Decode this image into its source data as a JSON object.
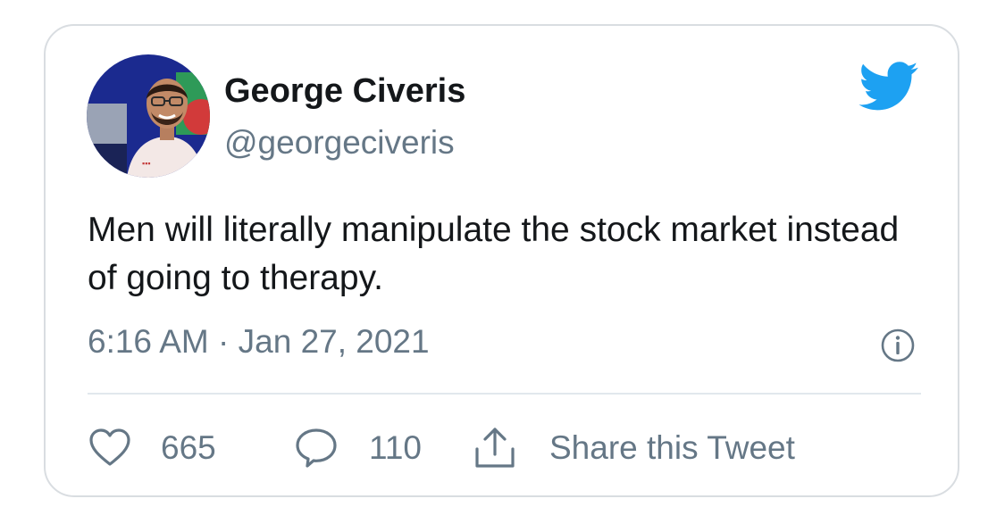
{
  "author": {
    "name": "George Civeris",
    "handle": "@georgeciveris"
  },
  "tweet": {
    "text": "Men will literally manipulate the stock market instead of going to therapy.",
    "timestamp": "6:16 AM · Jan 27, 2021"
  },
  "actions": {
    "likes": "665",
    "replies": "110",
    "share_label": "Share this Tweet"
  },
  "icons": {
    "brand": "twitter-bird-icon",
    "info": "info-icon",
    "like": "heart-icon",
    "reply": "speech-bubble-icon",
    "share": "share-upload-icon"
  },
  "colors": {
    "brand_blue": "#1da1f2",
    "text_primary": "#14171a",
    "text_secondary": "#657786",
    "border": "#d9dde1"
  }
}
